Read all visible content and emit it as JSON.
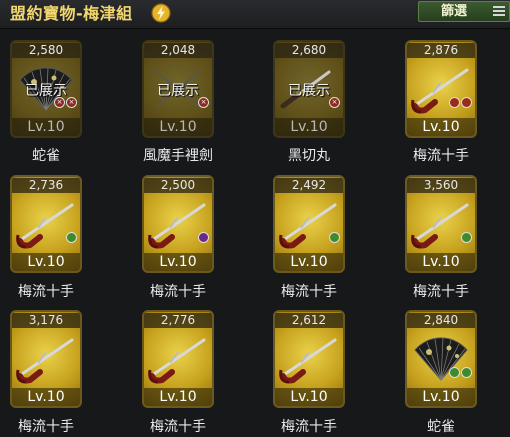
{
  "header": {
    "title": "盟約寶物-梅津組",
    "title_icon": "lightning-icon",
    "filter_label": "篩選",
    "filter_icon": "menu-icon"
  },
  "colors": {
    "title": "#f2d66e",
    "tile_gold": "#c6a11d",
    "filter_green": "#3b5b2f"
  },
  "items": [
    {
      "cost": "2,580",
      "level": "Lv.10",
      "name": "蛇雀",
      "status": "已展示",
      "dimmed": true,
      "art": "fan",
      "badges": [
        "x",
        "x"
      ]
    },
    {
      "cost": "2,048",
      "level": "Lv.10",
      "name": "風魔手裡劍",
      "status": "已展示",
      "dimmed": true,
      "art": "shuriken",
      "badges": [
        "x"
      ]
    },
    {
      "cost": "2,680",
      "level": "Lv.10",
      "name": "黑切丸",
      "status": "已展示",
      "dimmed": true,
      "art": "katana",
      "badges": [
        "x"
      ]
    },
    {
      "cost": "2,876",
      "level": "Lv.10",
      "name": "梅流十手",
      "status": "",
      "dimmed": false,
      "art": "jitte",
      "badges": [
        "r",
        "r"
      ]
    },
    {
      "cost": "2,736",
      "level": "Lv.10",
      "name": "梅流十手",
      "status": "",
      "dimmed": false,
      "art": "jitte",
      "badges": [
        "g"
      ]
    },
    {
      "cost": "2,500",
      "level": "Lv.10",
      "name": "梅流十手",
      "status": "",
      "dimmed": false,
      "art": "jitte",
      "badges": [
        "p"
      ]
    },
    {
      "cost": "2,492",
      "level": "Lv.10",
      "name": "梅流十手",
      "status": "",
      "dimmed": false,
      "art": "jitte",
      "badges": [
        "g"
      ]
    },
    {
      "cost": "3,560",
      "level": "Lv.10",
      "name": "梅流十手",
      "status": "",
      "dimmed": false,
      "art": "jitte",
      "badges": [
        "g"
      ]
    },
    {
      "cost": "3,176",
      "level": "Lv.10",
      "name": "梅流十手",
      "status": "",
      "dimmed": false,
      "art": "jitte",
      "badges": []
    },
    {
      "cost": "2,776",
      "level": "Lv.10",
      "name": "梅流十手",
      "status": "",
      "dimmed": false,
      "art": "jitte",
      "badges": []
    },
    {
      "cost": "2,612",
      "level": "Lv.10",
      "name": "梅流十手",
      "status": "",
      "dimmed": false,
      "art": "jitte",
      "badges": []
    },
    {
      "cost": "2,840",
      "level": "Lv.10",
      "name": "蛇雀",
      "status": "",
      "dimmed": false,
      "art": "fan",
      "badges": [
        "g",
        "g"
      ]
    }
  ]
}
